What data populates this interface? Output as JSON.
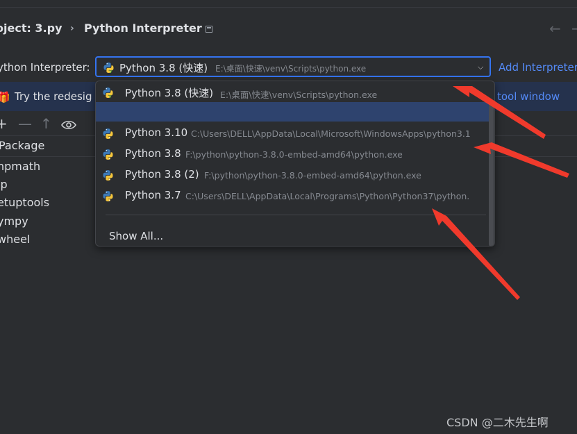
{
  "header": {
    "breadcrumb_project": "oject: 3.py",
    "breadcrumb_separator": "›",
    "page_title": "Python Interpreter",
    "back_arrow": "←",
    "forward_arrow": "→"
  },
  "interpreter": {
    "label": "ython Interpreter:",
    "selected_name": "Python 3.8 (快速)",
    "selected_path": "E:\\桌面\\快速\\venv\\Scripts\\python.exe",
    "dropdown_arrow": "⌵",
    "add_link": "Add Interpreter"
  },
  "banner": {
    "gift_icon": "gift-icon",
    "text": "Try the redesig",
    "link": "tool window"
  },
  "toolbar": {
    "add": "+",
    "remove": "—",
    "upgrade": "↑",
    "eye": "◉"
  },
  "packages": {
    "header": "Package",
    "items": [
      "npmath",
      "ip",
      "etuptools",
      "ympy",
      "wheel"
    ]
  },
  "dropdown": {
    "items": [
      {
        "name": "Python 3.8 (快速)",
        "path": "E:\\桌面\\快速\\venv\\Scripts\\python.exe",
        "icon": "python-venv-icon"
      },
      {
        "name": "Python 3.10",
        "path": "C:\\Users\\DELL\\AppData\\Local\\Microsoft\\WindowsApps\\python3.1",
        "icon": "python-icon"
      },
      {
        "name": "Python 3.8",
        "path": "F:\\python\\python-3.8.0-embed-amd64\\python.exe",
        "icon": "python-icon"
      },
      {
        "name": "Python 3.8 (2)",
        "path": "F:\\python\\python-3.8.0-embed-amd64\\python.exe",
        "icon": "python-icon"
      },
      {
        "name": "Python 3.7",
        "path": "C:\\Users\\DELL\\AppData\\Local\\Programs\\Python\\Python37\\python.",
        "icon": "python-icon"
      }
    ],
    "show_all": "Show All..."
  },
  "colors": {
    "accent": "#3574f0",
    "link": "#548af7",
    "selection": "#2e436e",
    "annotation_arrow": "#f03a2c"
  },
  "watermark": "CSDN @二木先生啊"
}
